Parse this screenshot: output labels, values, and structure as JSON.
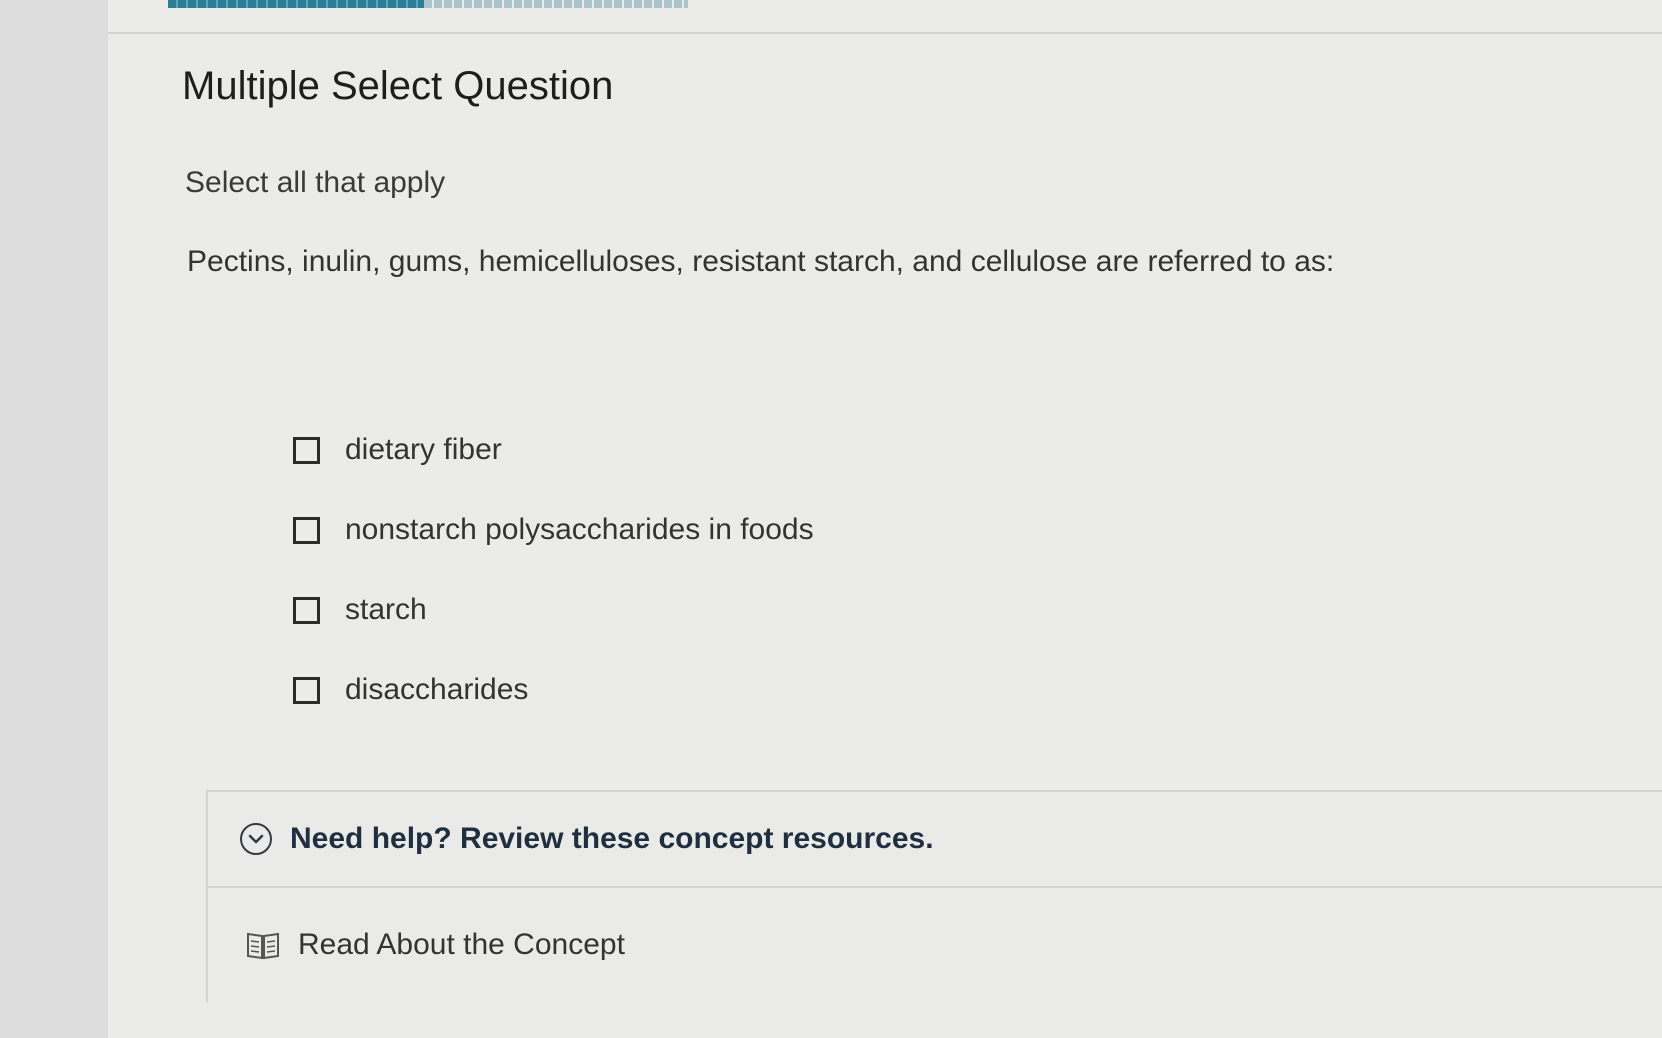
{
  "question": {
    "title": "Multiple Select Question",
    "instruction": "Select all that apply",
    "prompt": "Pectins, inulin, gums, hemicelluloses, resistant starch, and cellulose are referred to as:",
    "options": [
      {
        "label": "dietary fiber",
        "checked": false
      },
      {
        "label": "nonstarch polysaccharides in foods",
        "checked": false
      },
      {
        "label": "starch",
        "checked": false
      },
      {
        "label": "disaccharides",
        "checked": false
      }
    ]
  },
  "help": {
    "header": "Need help? Review these concept resources.",
    "resource": "Read About the Concept",
    "header_icon": "chevron-down-circle-icon",
    "resource_icon": "book-icon"
  },
  "progress": {
    "completed_fraction": 0.49
  },
  "colors": {
    "progress": "#2a7f96",
    "help_text": "#1f2f40"
  }
}
